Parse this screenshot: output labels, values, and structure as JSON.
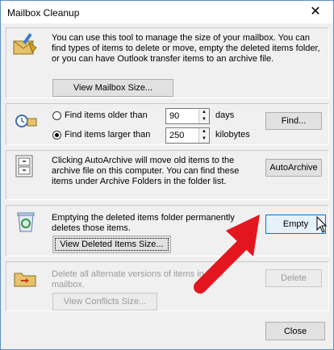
{
  "window": {
    "title": "Mailbox Cleanup",
    "close_glyph": "✕"
  },
  "size_section": {
    "text": "You can use this tool to manage the size of your mailbox. You can find types of items to delete or move, empty the deleted items folder, or you can have Outlook transfer items to an archive file.",
    "view_button": "View Mailbox Size..."
  },
  "find_section": {
    "option_older": "Find items older than",
    "older_value": "90",
    "older_unit": "days",
    "option_larger": "Find items larger than",
    "larger_value": "250",
    "larger_unit": "kilobytes",
    "selected": "larger",
    "find_button": "Find..."
  },
  "archive_section": {
    "text": "Clicking AutoArchive will move old items to the archive file on this computer. You can find these items under Archive Folders in the folder list.",
    "button": "AutoArchive"
  },
  "deleted_section": {
    "text": "Emptying the deleted items folder permanently deletes those items.",
    "empty_button": "Empty",
    "view_button": "View Deleted Items Size..."
  },
  "conflicts_section": {
    "text": "Delete all alternate versions of items in your mailbox.",
    "delete_button": "Delete",
    "view_button": "View Conflicts Size..."
  },
  "footer": {
    "close_button": "Close"
  },
  "colors": {
    "accent": "#0078d7",
    "arrow": "#e3161f"
  }
}
